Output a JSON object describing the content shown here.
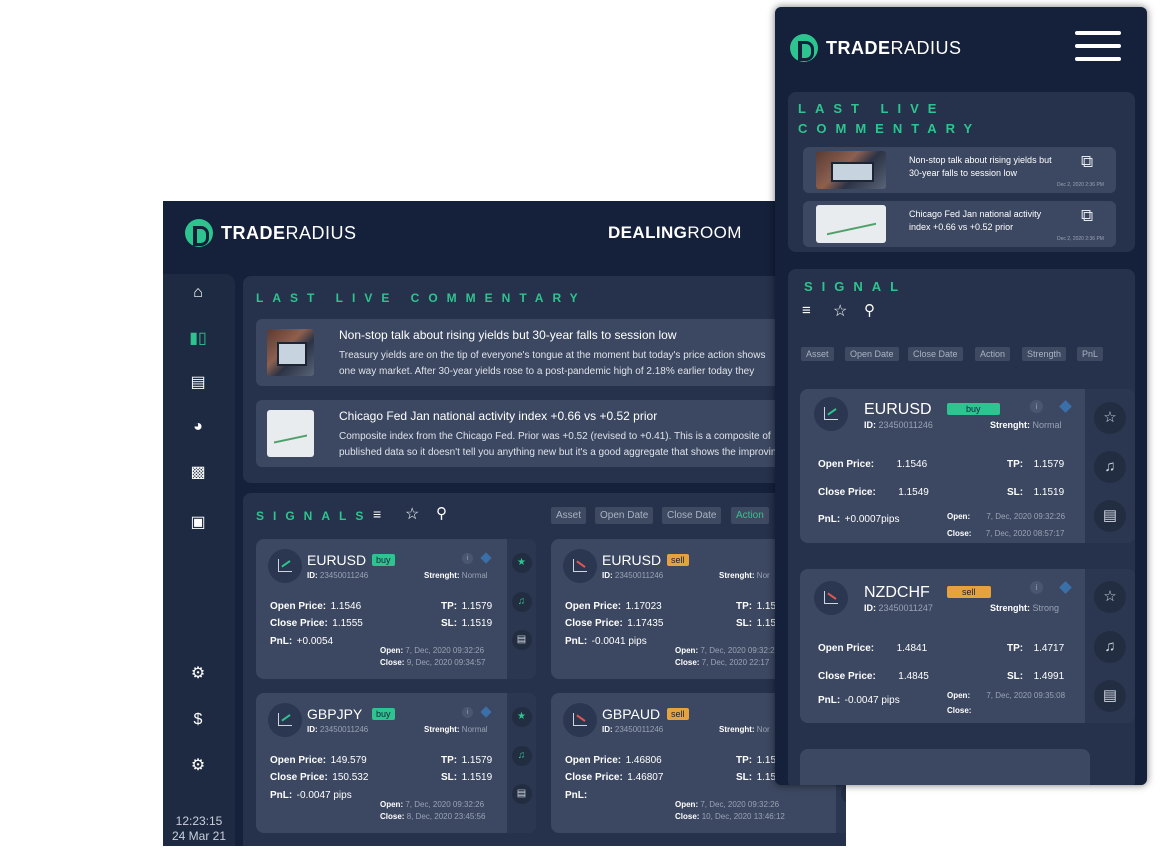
{
  "brand": {
    "name_bold": "TRADE",
    "name_light": "RADIUS"
  },
  "desktop": {
    "room_bold": "DEALING",
    "room_light": "ROOM",
    "sidebar_icons": [
      "home-icon",
      "candles-icon",
      "news-icon",
      "pie-chart-icon",
      "bar-chart-icon",
      "gift-icon",
      "support-icon",
      "dollar-gear-icon",
      "settings-icon"
    ],
    "time": "12:23:15",
    "date": "24 Mar 21",
    "commentary_title": "LAST LIVE COMMENTARY",
    "news": [
      {
        "title": "Non-stop talk about rising yields but 30-year falls to session low",
        "line1": "Treasury yields are on the tip of everyone's tongue at the moment but today's price action shows",
        "line2": "one way market.  After  30-year yields rose to a post-pandemic high of 2.18% earlier today they"
      },
      {
        "title": "Chicago Fed Jan national activity index +0.66 vs +0.52 prior",
        "line1": "Composite index from the Chicago Fed. Prior was +0.52 (revised to +0.41). This is a composite of",
        "line2": "published data so it doesn't tell you anything new but it's a good aggregate that shows the improving"
      }
    ],
    "signals_title": "SIGNALS",
    "filters": [
      "Asset",
      "Open Date",
      "Close Date",
      "Action"
    ],
    "signals": [
      {
        "symbol": "EURUSD",
        "action": "buy",
        "id_label": "ID:",
        "id": "23450011246",
        "strength_label": "Strenght:",
        "strength": "Normal",
        "open_price": "1.1546",
        "close_price": "1.1555",
        "tp": "1.1579",
        "sl": "1.1519",
        "pnl": "+0.0054",
        "open_date": "7, Dec, 2020 09:32:26",
        "close_date": "9, Dec, 2020 09:34:57"
      },
      {
        "symbol": "EURUSD",
        "action": "sell",
        "id_label": "ID:",
        "id": "23450011246",
        "strength_label": "Strenght:",
        "strength": "Nor",
        "open_price": "1.17023",
        "close_price": "1.17435",
        "tp": "1.15",
        "sl": "1.15",
        "pnl": "-0.0041 pips",
        "open_date": "7, Dec, 2020 09:32:26",
        "close_date": "7, Dec, 2020 22:17"
      },
      {
        "symbol": "GBPJPY",
        "action": "buy",
        "id_label": "ID:",
        "id": "23450011246",
        "strength_label": "Strenght:",
        "strength": "Normal",
        "open_price": "149.579",
        "close_price": "150.532",
        "tp": "1.1579",
        "sl": "1.1519",
        "pnl": "-0.0047 pips",
        "open_date": "7, Dec, 2020 09:32:26",
        "close_date": "8, Dec, 2020 23:45:56"
      },
      {
        "symbol": "GBPAUD",
        "action": "sell",
        "id_label": "ID:",
        "id": "23450011246",
        "strength_label": "Strenght:",
        "strength": "Nor",
        "open_price": "1.46806",
        "close_price": "1.46807",
        "tp": "1.15",
        "sl": "1.15",
        "pnl": "",
        "open_date": "7, Dec, 2020 09:32:26",
        "close_date": "10, Dec, 2020 13:46:12"
      }
    ]
  },
  "mobile": {
    "commentary_title_1": "LAST LIVE",
    "commentary_title_2": "COMMENTARY",
    "news": [
      {
        "line1": "Non-stop talk about rising yields but",
        "line2": "30-year falls to session low",
        "date": "Dec 2, 2020 2:36 PM"
      },
      {
        "line1": "Chicago Fed Jan national activity",
        "line2": "index +0.66 vs +0.52 prior",
        "date": "Dec 2, 2020 2:36 PM"
      }
    ],
    "signal_title": "SIGNAL",
    "filters": [
      "Asset",
      "Open Date",
      "Close Date",
      "Action",
      "Strength",
      "PnL"
    ],
    "signals": [
      {
        "symbol": "EURUSD",
        "action": "buy",
        "id_label": "ID:",
        "id": "23450011246",
        "strength_label": "Strenght:",
        "strength": "Normal",
        "open_price": "1.1546",
        "close_price": "1.1549",
        "tp": "1.1579",
        "sl": "1.1519",
        "pnl": "+0.0007pips",
        "open_date": "7, Dec, 2020 09:32:26",
        "close_date": "7, Dec, 2020 08:57:17"
      },
      {
        "symbol": "NZDCHF",
        "action": "sell",
        "id_label": "ID:",
        "id": "23450011247",
        "strength_label": "Strenght:",
        "strength": "Strong",
        "open_price": "1.4841",
        "close_price": "1.4845",
        "tp": "1.4717",
        "sl": "1.4991",
        "pnl": "-0.0047 pips",
        "open_date": "7, Dec, 2020 09:35:08",
        "close_date": ""
      }
    ]
  },
  "labels": {
    "open_price": "Open Price:",
    "close_price": "Close Price:",
    "tp": "TP:",
    "sl": "SL:",
    "pnl": "PnL:",
    "open": "Open:",
    "close": "Close:",
    "info": "i"
  },
  "colors": {
    "bg": "#15213a",
    "panel": "#26324b",
    "card": "#3c4861",
    "accent": "#2ec48f",
    "sell": "#e6a23c"
  }
}
